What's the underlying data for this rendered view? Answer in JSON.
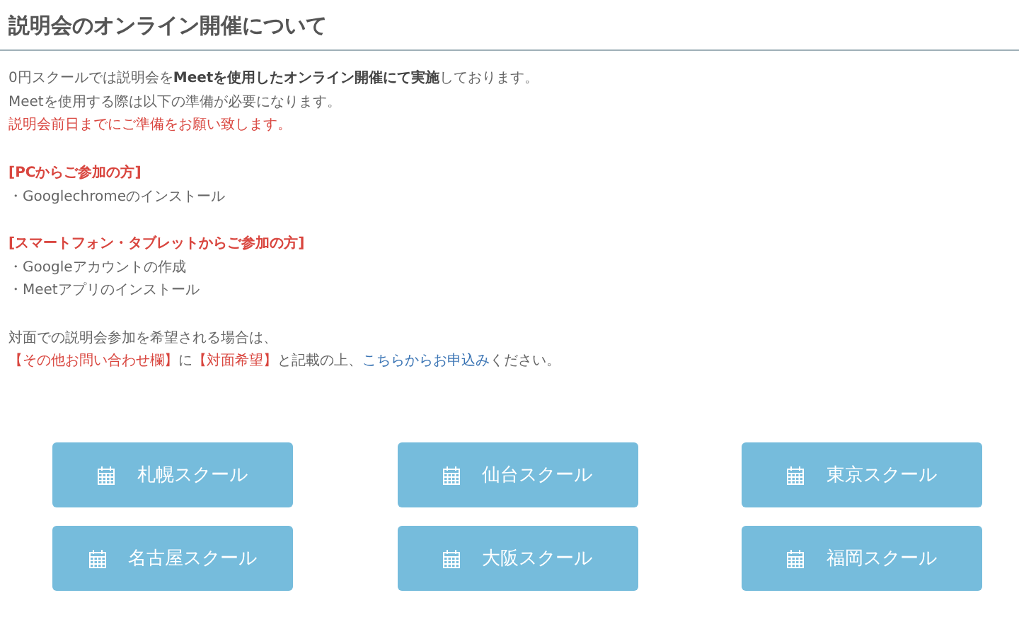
{
  "title": "説明会のオンライン開催について",
  "intro": [
    {
      "kind": "plain",
      "text": "0円スクールでは説明会を**Meetを使用したオンライン開催にて実施**しております。"
    },
    {
      "kind": "plain",
      "text": "Meetを使用する際は以下の準備が必要になります。"
    },
    {
      "kind": "red",
      "text": "説明会前日までにご準備をお願い致します。"
    }
  ],
  "sections": [
    {
      "heading": "[PCからご参加の方]",
      "items": [
        "・Googlechromeのインストール"
      ]
    },
    {
      "heading": "[スマートフォン・タブレットからご参加の方]",
      "items": [
        "・Googleアカウントの作成",
        "・Meetアプリのインストール"
      ]
    }
  ],
  "closing": "対面での説明会参加を希望される場合は、",
  "closing_line": [
    {
      "kind": "red",
      "text": "【その他お問い合わせ欄】"
    },
    {
      "kind": "plain",
      "text": "に"
    },
    {
      "kind": "red",
      "text": "【対面希望】"
    },
    {
      "kind": "plain",
      "text": "と記載の上、"
    },
    {
      "kind": "link",
      "text": "こちらからお申込み"
    },
    {
      "kind": "plain",
      "text": "ください。"
    }
  ],
  "schools": [
    "札幌スクール",
    "仙台スクール",
    "東京スクール",
    "名古屋スクール",
    "大阪スクール",
    "福岡スクール"
  ]
}
